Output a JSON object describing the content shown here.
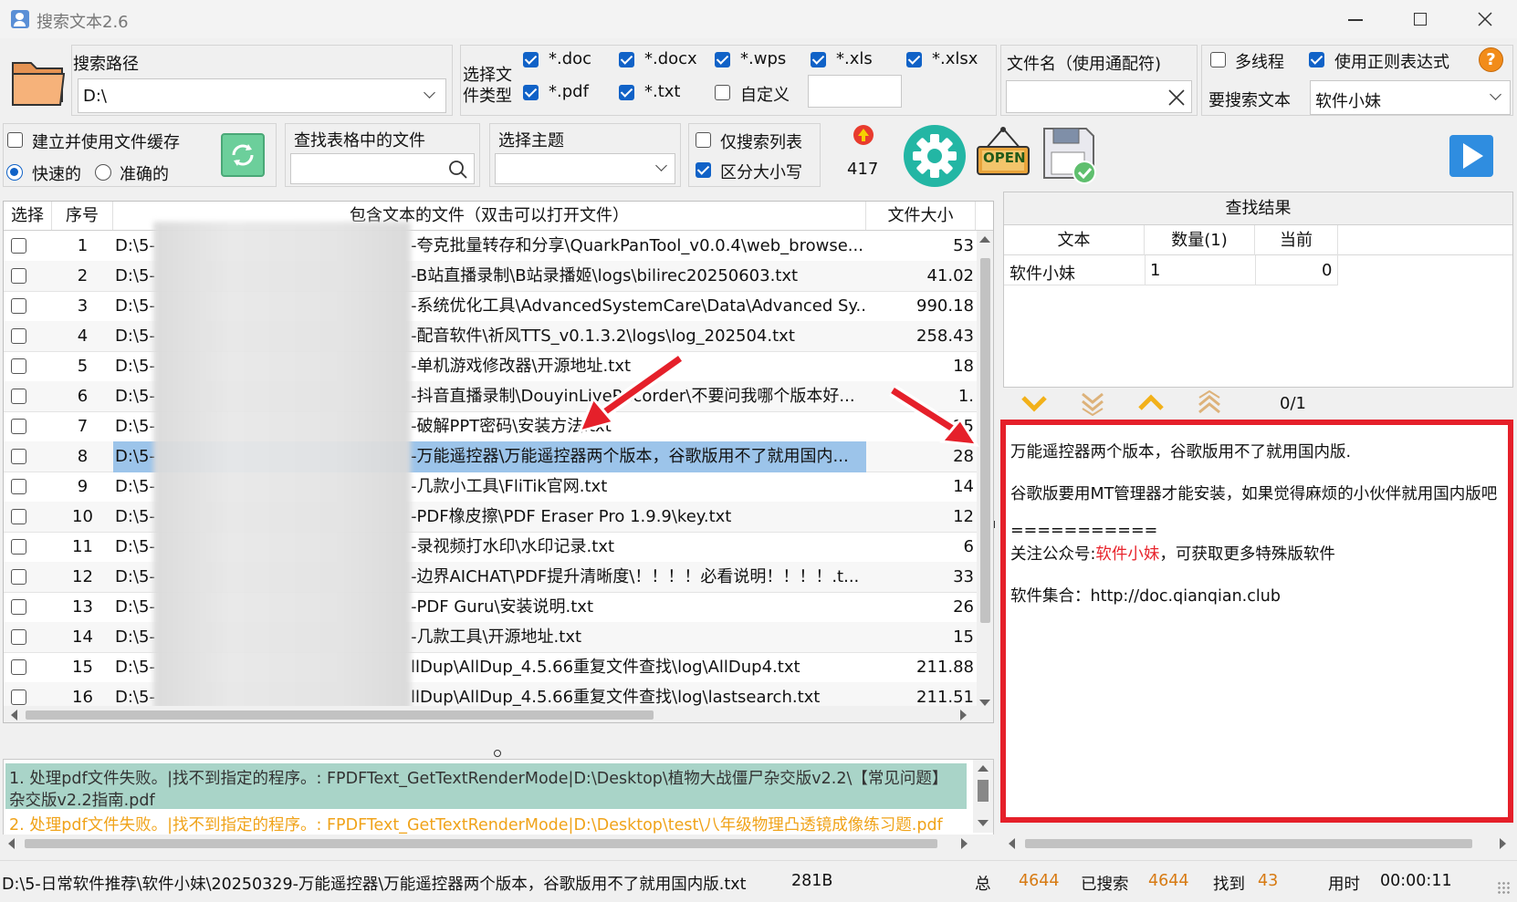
{
  "window": {
    "title": "搜索文本2.6"
  },
  "search_path": {
    "label": "搜索路径",
    "value": "D:\\"
  },
  "file_types": {
    "label_line1": "选择文",
    "label_line2": "件类型",
    "items": [
      {
        "label": "*.doc",
        "checked": true
      },
      {
        "label": "*.docx",
        "checked": true
      },
      {
        "label": "*.wps",
        "checked": true
      },
      {
        "label": "*.xls",
        "checked": true
      },
      {
        "label": "*.xlsx",
        "checked": true
      },
      {
        "label": "*.pdf",
        "checked": true
      },
      {
        "label": "*.txt",
        "checked": true
      },
      {
        "label": "自定义",
        "checked": false
      }
    ]
  },
  "filename": {
    "label": "文件名（使用通配符)",
    "value": ""
  },
  "options": {
    "multithread": {
      "label": "多线程",
      "checked": false
    },
    "regex": {
      "label": "使用正则表达式",
      "checked": true
    },
    "search_text_label": "要搜索文本",
    "search_text_value": "软件小妹",
    "help": "?"
  },
  "cache": {
    "label": "建立并使用文件缓存",
    "checked": false,
    "fast": "快速的",
    "accurate": "准确的"
  },
  "table_search": {
    "label": "查找表格中的文件",
    "value": ""
  },
  "theme": {
    "label": "选择主题",
    "value": ""
  },
  "list_only": {
    "label": "仅搜索列表",
    "checked": false
  },
  "case_sensitive": {
    "label": "区分大小写",
    "checked": true
  },
  "count": "417",
  "open_sign": "OPEN",
  "grid": {
    "headers": {
      "select": "选择",
      "index": "序号",
      "file": "包含文本的文件（双击可以打开文件）",
      "size": "文件大小"
    },
    "rows": [
      {
        "no": "1",
        "prefix": "D:\\5-",
        "path": "-夸克批量转存和分享\\QuarkPanTool_v0.0.4\\web_browse...",
        "size": "53"
      },
      {
        "no": "2",
        "prefix": "D:\\5-",
        "path": "-B站直播录制\\B站录播姬\\logs\\bilirec20250603.txt",
        "size": "41.02"
      },
      {
        "no": "3",
        "prefix": "D:\\5-",
        "path": "-系统优化工具\\AdvancedSystemCare\\Data\\Advanced Sy...",
        "size": "990.18"
      },
      {
        "no": "4",
        "prefix": "D:\\5-",
        "path": "-配音软件\\祈风TTS_v0.1.3.2\\logs\\log_202504.txt",
        "size": "258.43"
      },
      {
        "no": "5",
        "prefix": "D:\\5-",
        "path": "-单机游戏修改器\\开源地址.txt",
        "size": "18"
      },
      {
        "no": "6",
        "prefix": "D:\\5-",
        "path": "-抖音直播录制\\DouyinLiveRecorder\\不要问我哪个版本好...",
        "size": "1."
      },
      {
        "no": "7",
        "prefix": "D:\\5-",
        "path": "-破解PPT密码\\安装方法.txt",
        "size": "25"
      },
      {
        "no": "8",
        "prefix": "D:\\5-",
        "path": "-万能遥控器\\万能遥控器两个版本，谷歌版用不了就用国内...",
        "size": "28"
      },
      {
        "no": "9",
        "prefix": "D:\\5-",
        "path": "-几款小工具\\FliTik官网.txt",
        "size": "14"
      },
      {
        "no": "10",
        "prefix": "D:\\5-",
        "path": "-PDF橡皮擦\\PDF Eraser Pro 1.9.9\\key.txt",
        "size": "12"
      },
      {
        "no": "11",
        "prefix": "D:\\5-",
        "path": "-录视频打水印\\水印记录.txt",
        "size": "6"
      },
      {
        "no": "12",
        "prefix": "D:\\5-",
        "path": "-边界AICHAT\\PDF提升清晰度\\！！！！必看说明！！！！.t...",
        "size": "33"
      },
      {
        "no": "13",
        "prefix": "D:\\5-",
        "path": "-PDF Guru\\安装说明.txt",
        "size": "26"
      },
      {
        "no": "14",
        "prefix": "D:\\5-",
        "path": "-几款工具\\开源地址.txt",
        "size": "15"
      },
      {
        "no": "15",
        "prefix": "D:\\5-",
        "path": "llDup\\AllDup_4.5.66重复文件查找\\log\\AllDup4.txt",
        "size": "211.88"
      },
      {
        "no": "16",
        "prefix": "D:\\5-",
        "path": "llDup\\AllDup_4.5.66重复文件查找\\log\\lastsearch.txt",
        "size": "211.51"
      }
    ]
  },
  "results": {
    "title": "查找结果",
    "headers": {
      "text": "文本",
      "count": "数量(1)",
      "current": "当前"
    },
    "row": {
      "text": "软件小妹",
      "count": "1",
      "current": "0"
    },
    "nav_count": "0/1"
  },
  "preview": {
    "line1": "万能遥控器两个版本，谷歌版用不了就用国内版.",
    "line2": "谷歌版要用MT管理器才能安装，如果觉得麻烦的小伙伴就用国内版吧",
    "line3": "===========",
    "line4_pre": "关注公众号:",
    "line4_hl": "软件小妹",
    "line4_post": "，可获取更多特殊版软件",
    "line5": "软件集合：http://doc.qianqian.club",
    "highlight_color": "#e8242c"
  },
  "log": {
    "line1a": "1. 处理pdf文件失败。|找不到指定的程序。: FPDFText_GetTextRenderMode|D:\\Desktop\\植物大战僵尸杂交版v2.2\\【常见问题】",
    "line1b": "杂交版v2.2指南.pdf",
    "line2": "2. 处理pdf文件失败。|找不到指定的程序。: FPDFText_GetTextRenderMode|D:\\Desktop\\test\\八年级物理凸透镜成像练习题.pdf"
  },
  "status": {
    "path": "D:\\5-日常软件推荐\\软件小妹\\20250329-万能遥控器\\万能遥控器两个版本，谷歌版用不了就用国内版.txt",
    "size": "281B",
    "total_label": "总",
    "total": "4644",
    "searched_label": "已搜索",
    "searched": "4644",
    "found_label": "找到",
    "found": "43",
    "time_label": "用时",
    "time": "00:00:11"
  },
  "colors": {
    "accent": "#1062c7",
    "status_orange": "#d77a12",
    "red_box": "#e5202a",
    "log_green": "#a9d4c8",
    "log_orange": "#f0a31a"
  }
}
